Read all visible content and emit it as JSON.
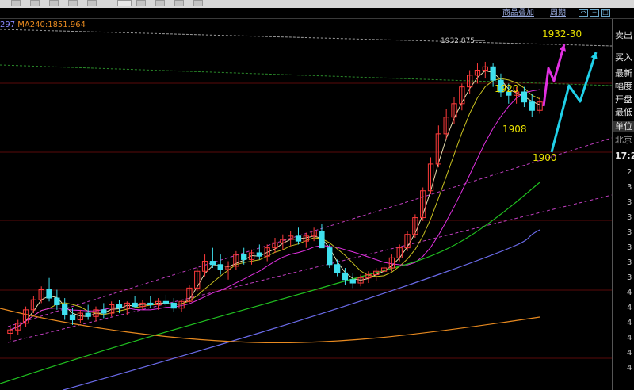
{
  "header": {
    "overlay_label": "商品叠加",
    "period_label": "周期"
  },
  "legend": {
    "prefix": "297",
    "ma240_label": "MA240:1851.964"
  },
  "side_panel": {
    "sell": "卖出",
    "buy": "买入",
    "latest": "最新",
    "change_pct": "幅度",
    "open": "开盘",
    "low": "最低",
    "unit": "单位",
    "location": "北京",
    "time": "17:2",
    "depth_digits": [
      "2",
      "3",
      "3",
      "3",
      "3",
      "3",
      "3",
      "3",
      "4",
      "4",
      "4",
      "4",
      "4",
      "4"
    ]
  },
  "chart_data": {
    "type": "candlestick",
    "title": "",
    "high_marker": "1932.875",
    "annotations": [
      {
        "text": "1932-30",
        "color": "#e8e000"
      },
      {
        "text": "1920",
        "color": "#e8e000"
      },
      {
        "text": "1908",
        "color": "#e8e000"
      },
      {
        "text": "1900",
        "color": "#e8e000"
      }
    ],
    "colors": {
      "up": "#ff3b3b",
      "down": "#3fe0ee",
      "ma_fast": "#e8e0b0",
      "ma_mid": "#c8c020",
      "ma_slow": "#e030e0",
      "ma_green": "#20c020",
      "ma_blue": "#6a6ae8",
      "ma240": "#e88a20",
      "channel": "#c03ec0",
      "projection_magenta": "#e030e0",
      "projection_cyan": "#20d0e8"
    },
    "ylim": [
      1740,
      1950
    ],
    "candles": [
      [
        1771,
        1775,
        1767,
        1773
      ],
      [
        1773,
        1779,
        1770,
        1777
      ],
      [
        1777,
        1787,
        1775,
        1785
      ],
      [
        1785,
        1793,
        1783,
        1791
      ],
      [
        1791,
        1799,
        1789,
        1797
      ],
      [
        1797,
        1804,
        1790,
        1792
      ],
      [
        1792,
        1797,
        1785,
        1788
      ],
      [
        1788,
        1792,
        1779,
        1782
      ],
      [
        1782,
        1786,
        1776,
        1779
      ],
      [
        1779,
        1785,
        1777,
        1783
      ],
      [
        1783,
        1788,
        1779,
        1781
      ],
      [
        1781,
        1787,
        1778,
        1785
      ],
      [
        1785,
        1789,
        1780,
        1783
      ],
      [
        1783,
        1790,
        1781,
        1788
      ],
      [
        1788,
        1791,
        1783,
        1786
      ],
      [
        1786,
        1790,
        1782,
        1789
      ],
      [
        1789,
        1793,
        1786,
        1787
      ],
      [
        1787,
        1791,
        1785,
        1789
      ],
      [
        1789,
        1793,
        1786,
        1788
      ],
      [
        1788,
        1792,
        1785,
        1790
      ],
      [
        1790,
        1794,
        1787,
        1789
      ],
      [
        1789,
        1792,
        1784,
        1786
      ],
      [
        1786,
        1791,
        1784,
        1790
      ],
      [
        1790,
        1800,
        1789,
        1798
      ],
      [
        1798,
        1810,
        1796,
        1808
      ],
      [
        1808,
        1818,
        1805,
        1814
      ],
      [
        1814,
        1822,
        1810,
        1812
      ],
      [
        1812,
        1818,
        1806,
        1809
      ],
      [
        1809,
        1814,
        1803,
        1811
      ],
      [
        1811,
        1820,
        1809,
        1818
      ],
      [
        1818,
        1822,
        1812,
        1815
      ],
      [
        1815,
        1821,
        1812,
        1819
      ],
      [
        1819,
        1824,
        1815,
        1817
      ],
      [
        1817,
        1824,
        1814,
        1822
      ],
      [
        1822,
        1828,
        1819,
        1825
      ],
      [
        1825,
        1830,
        1821,
        1827
      ],
      [
        1827,
        1832,
        1823,
        1829
      ],
      [
        1829,
        1834,
        1824,
        1826
      ],
      [
        1826,
        1831,
        1822,
        1829
      ],
      [
        1829,
        1834,
        1826,
        1832
      ],
      [
        1832,
        1836,
        1825,
        1822
      ],
      [
        1822,
        1824,
        1810,
        1812
      ],
      [
        1812,
        1815,
        1805,
        1807
      ],
      [
        1807,
        1810,
        1800,
        1803
      ],
      [
        1803,
        1807,
        1798,
        1801
      ],
      [
        1801,
        1806,
        1799,
        1804
      ],
      [
        1804,
        1808,
        1801,
        1806
      ],
      [
        1806,
        1810,
        1802,
        1808
      ],
      [
        1808,
        1812,
        1804,
        1810
      ],
      [
        1810,
        1818,
        1808,
        1816
      ],
      [
        1816,
        1824,
        1814,
        1822
      ],
      [
        1822,
        1832,
        1820,
        1830
      ],
      [
        1830,
        1842,
        1828,
        1840
      ],
      [
        1840,
        1858,
        1838,
        1856
      ],
      [
        1856,
        1876,
        1854,
        1872
      ],
      [
        1872,
        1895,
        1870,
        1890
      ],
      [
        1890,
        1905,
        1887,
        1900
      ],
      [
        1900,
        1912,
        1896,
        1908
      ],
      [
        1908,
        1920,
        1904,
        1918
      ],
      [
        1918,
        1928,
        1914,
        1925
      ],
      [
        1925,
        1932,
        1920,
        1928
      ],
      [
        1928,
        1933,
        1923,
        1930
      ],
      [
        1930,
        1932,
        1918,
        1922
      ],
      [
        1922,
        1926,
        1912,
        1915
      ],
      [
        1915,
        1920,
        1908,
        1913
      ],
      [
        1913,
        1918,
        1908,
        1915
      ],
      [
        1915,
        1918,
        1906,
        1909
      ],
      [
        1909,
        1914,
        1900,
        1904
      ],
      [
        1904,
        1912,
        1902,
        1909
      ]
    ]
  }
}
